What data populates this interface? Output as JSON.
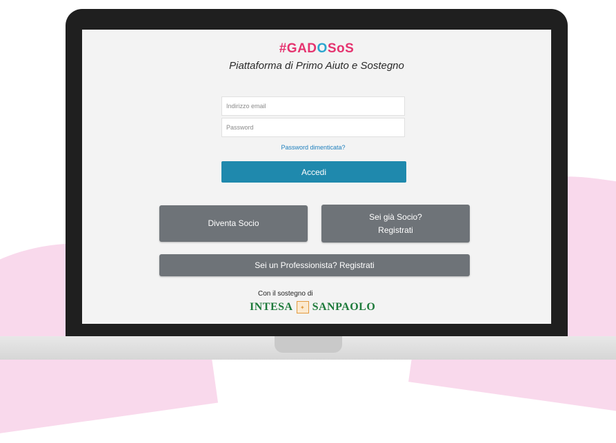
{
  "brand": {
    "part1": "#GAD",
    "part2": "O",
    "part3": "SoS",
    "tagline": "Piattaforma di Primo Aiuto e Sostegno"
  },
  "login": {
    "email_placeholder": "Indirizzo email",
    "password_placeholder": "Password",
    "forgot_link": "Password dimenticata?",
    "submit_label": "Accedi"
  },
  "actions": {
    "diventa_socio": "Diventa Socio",
    "sei_socio_line1": "Sei già Socio?",
    "sei_socio_line2": "Registrati",
    "professionista": "Sei un Professionista? Registrati"
  },
  "sponsor": {
    "intro": "Con il sostegno di",
    "name_left": "INTESA",
    "name_right": "SANPAOLO"
  },
  "colors": {
    "brand_pink": "#e5336f",
    "brand_blue": "#2aa5cf",
    "primary_button": "#1f89ad",
    "secondary_button": "#6e7378",
    "sponsor_green": "#1d7a3a"
  }
}
